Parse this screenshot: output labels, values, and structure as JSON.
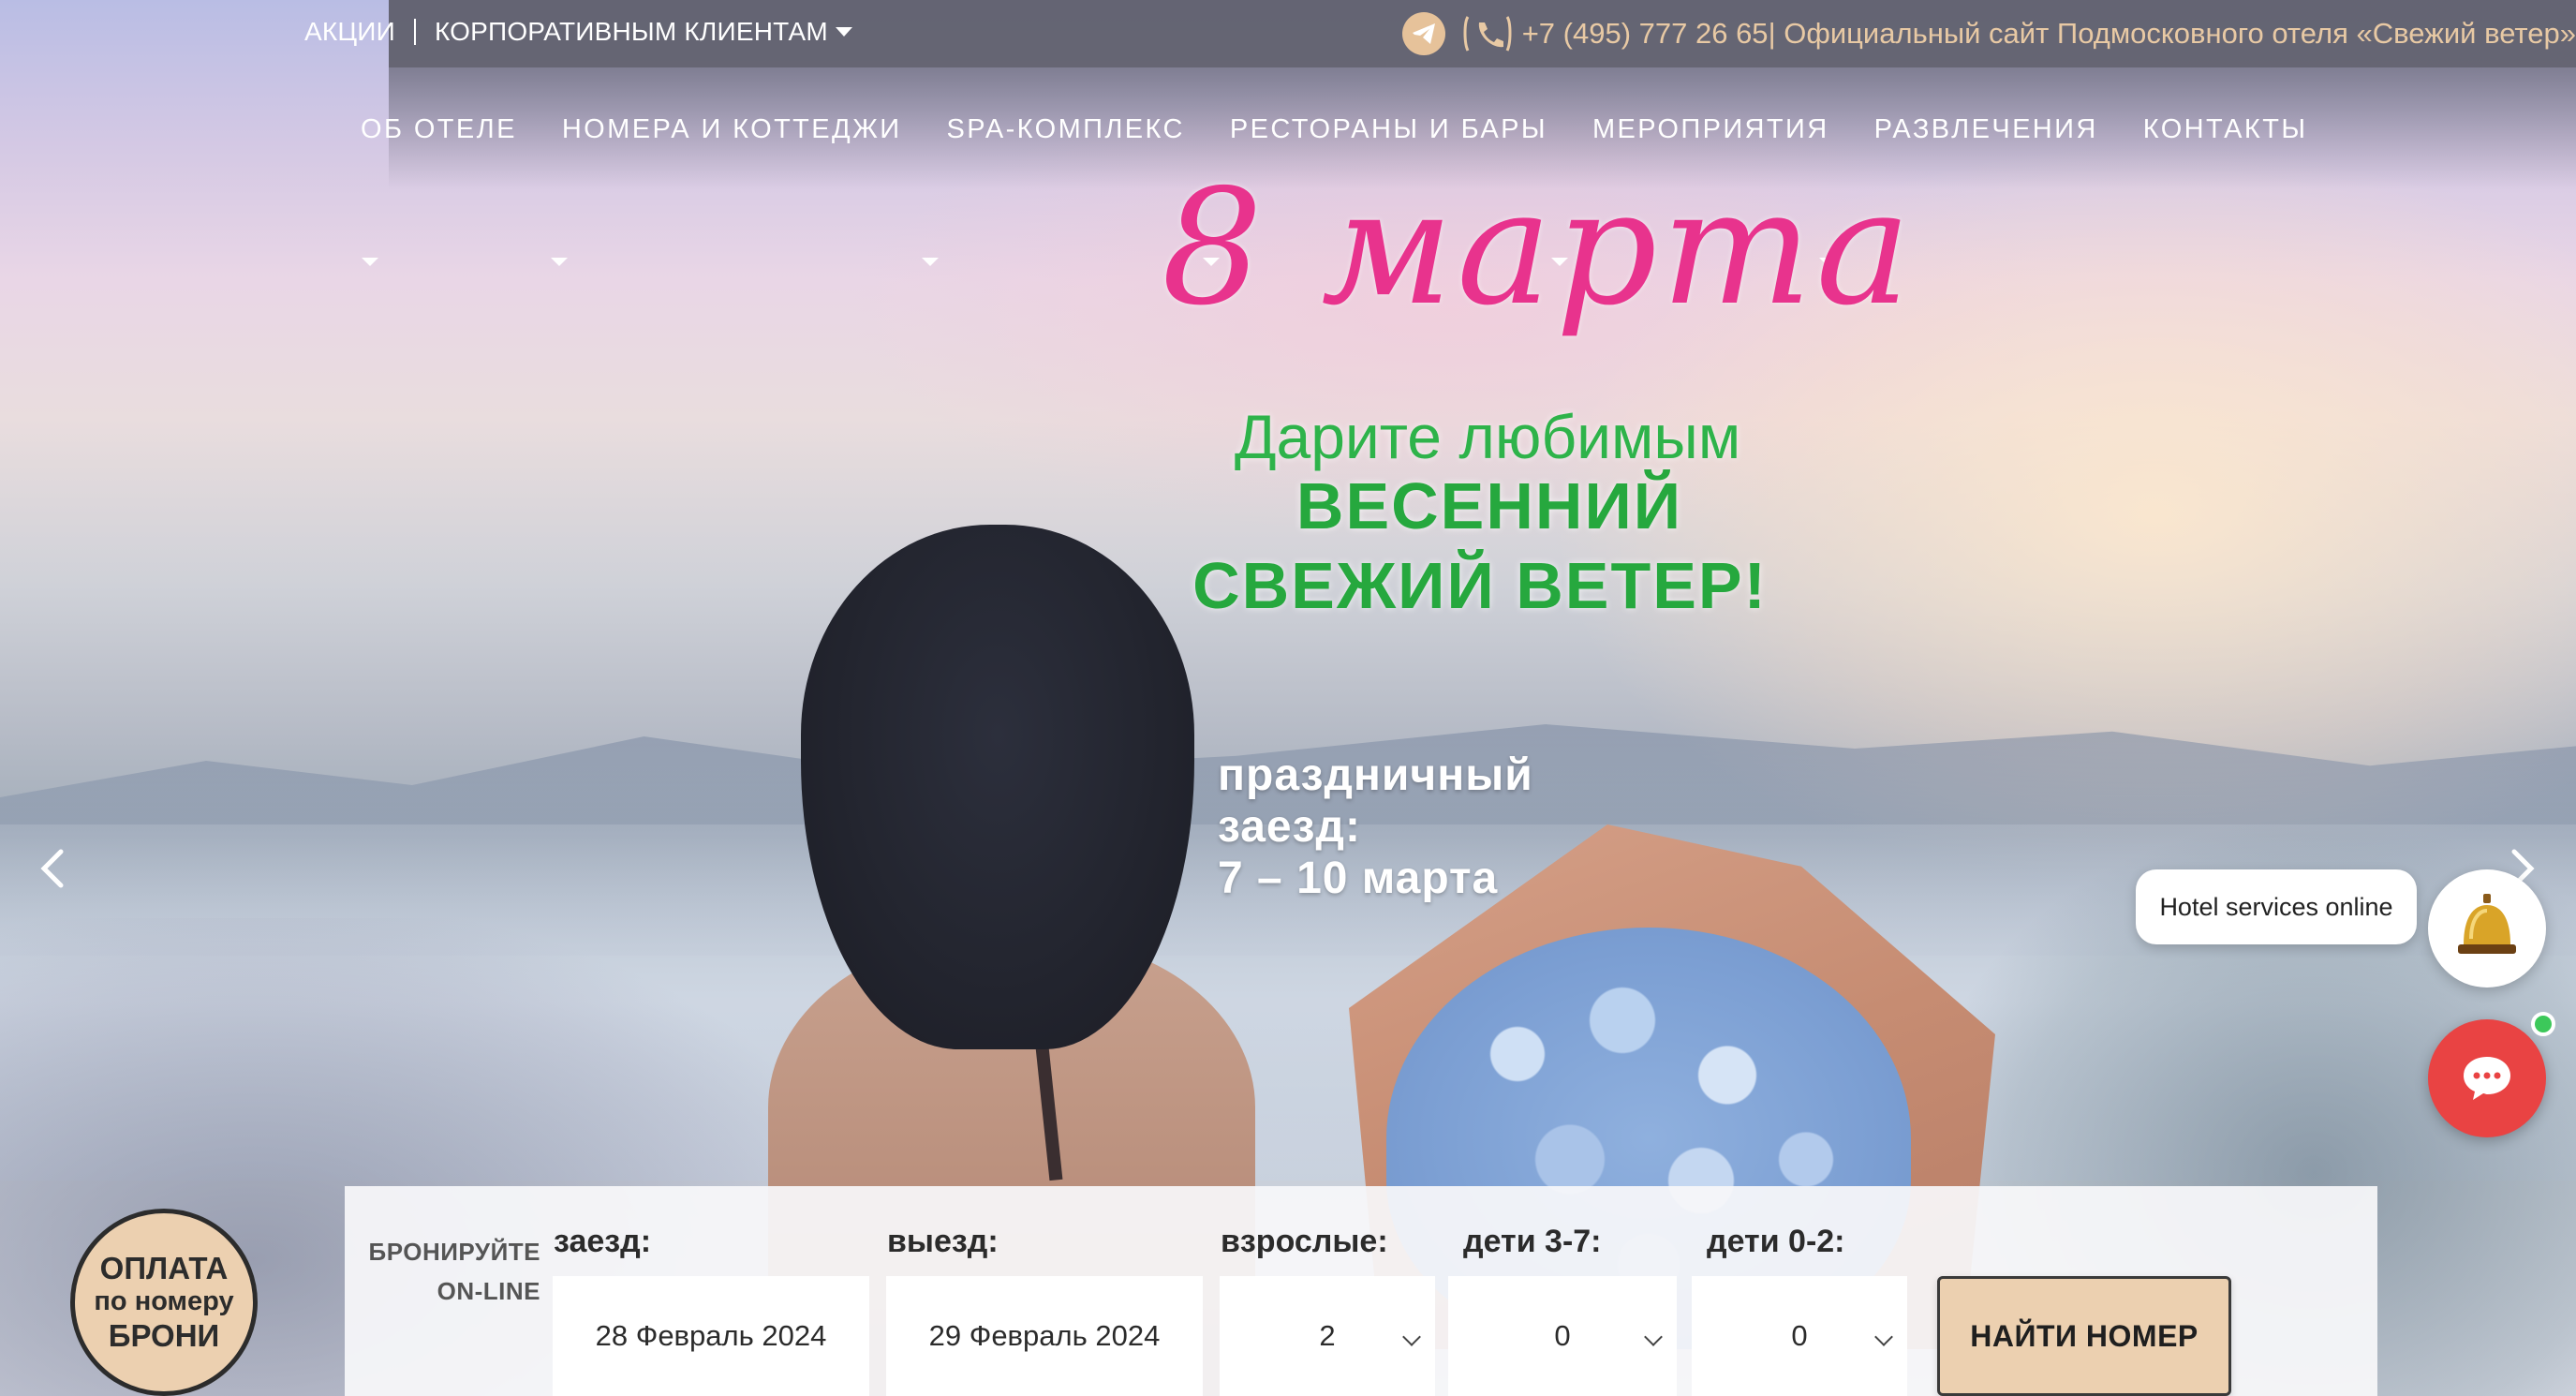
{
  "topbar": {
    "promo_link": "АКЦИИ",
    "corporate_link": "КОРПОРАТИВНЫМ КЛИЕНТАМ",
    "phone": "+7 (495) 777 26 65",
    "site_caption": " | Официальный сайт Подмосковного отеля «Свежий ветер»",
    "accent_color": "#e8c9a4"
  },
  "nav": {
    "items": [
      {
        "label": "ОБ ОТЕЛЕ"
      },
      {
        "label": "НОМЕРА И КОТТЕДЖИ"
      },
      {
        "label": "SPA-КОМПЛЕКС"
      },
      {
        "label": "РЕСТОРАНЫ И БАРЫ"
      },
      {
        "label": "МЕРОПРИЯТИЯ"
      },
      {
        "label": "РАЗВЛЕЧЕНИЯ"
      },
      {
        "label": "КОНТАКТЫ"
      }
    ]
  },
  "slide": {
    "title": "8 марта",
    "subtitle": "Дарите любимым",
    "line2": "ВЕСЕННИЙ",
    "line3": "СВЕЖИЙ ВЕТЕР!",
    "dates_line1": "праздничный",
    "dates_line2": "заезд:",
    "dates_line3": "7 – 10 марта",
    "title_color": "#e8338d",
    "accent_green": "#26a83e"
  },
  "chat": {
    "bubble_text": "Hotel services online",
    "bell_icon": "bell-icon",
    "chat_icon": "chat-icon",
    "chat_color": "#e94343",
    "online_color": "#3cc85a"
  },
  "pay_badge": {
    "line1": "ОПЛАТА",
    "line2": "по номеру",
    "line3": "БРОНИ"
  },
  "booking": {
    "label_line1": "БРОНИРУЙТЕ",
    "label_line2": "ON-LINE",
    "checkin_label": "заезд:",
    "checkin_value": "28 Февраль 2024",
    "checkout_label": "выезд:",
    "checkout_value": "29 Февраль 2024",
    "adults_label": "взрослые:",
    "adults_value": "2",
    "kids37_label": "дети 3-7:",
    "kids37_value": "0",
    "kids02_label": "дети 0-2:",
    "kids02_value": "0",
    "find_button": "НАЙТИ НОМЕР",
    "button_color": "#ecd0b0"
  }
}
